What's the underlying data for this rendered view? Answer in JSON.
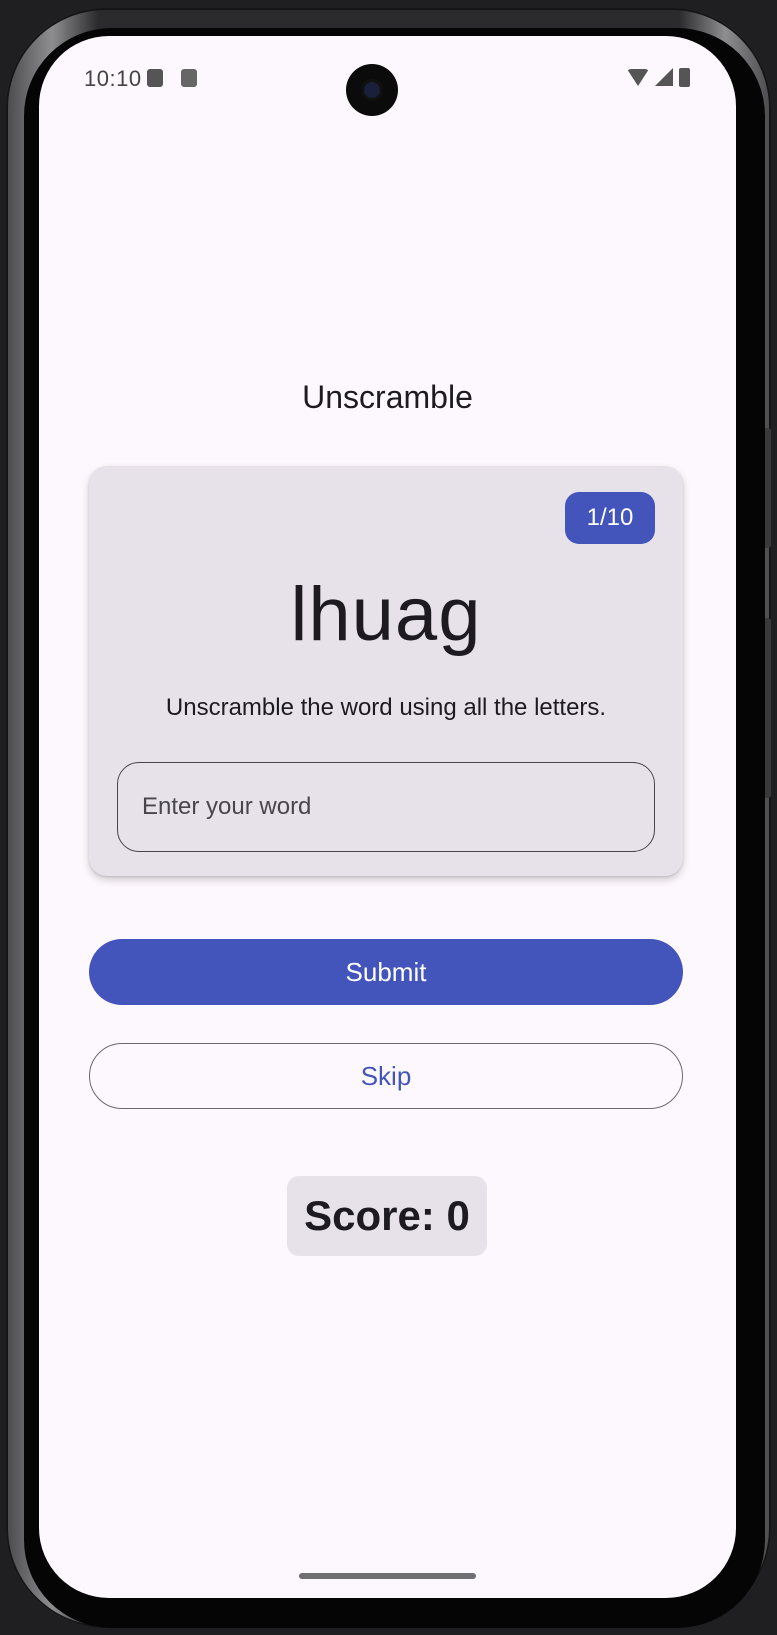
{
  "status_bar": {
    "time": "10:10",
    "icons": [
      "sd-card-icon",
      "notification-icon",
      "wifi-icon",
      "signal-icon",
      "battery-icon"
    ]
  },
  "app": {
    "title": "Unscramble"
  },
  "game_card": {
    "word_count": "1/10",
    "scrambled_word": "lhuag",
    "instructions": "Unscramble the word using all the letters.",
    "input": {
      "value": "",
      "placeholder": "Enter your word"
    }
  },
  "actions": {
    "submit_label": "Submit",
    "skip_label": "Skip"
  },
  "score": {
    "label": "Score: 0"
  },
  "colors": {
    "primary": "#4355ba",
    "background": "#fdf8fd",
    "card": "#e7e2e9",
    "text": "#1d1b20"
  }
}
